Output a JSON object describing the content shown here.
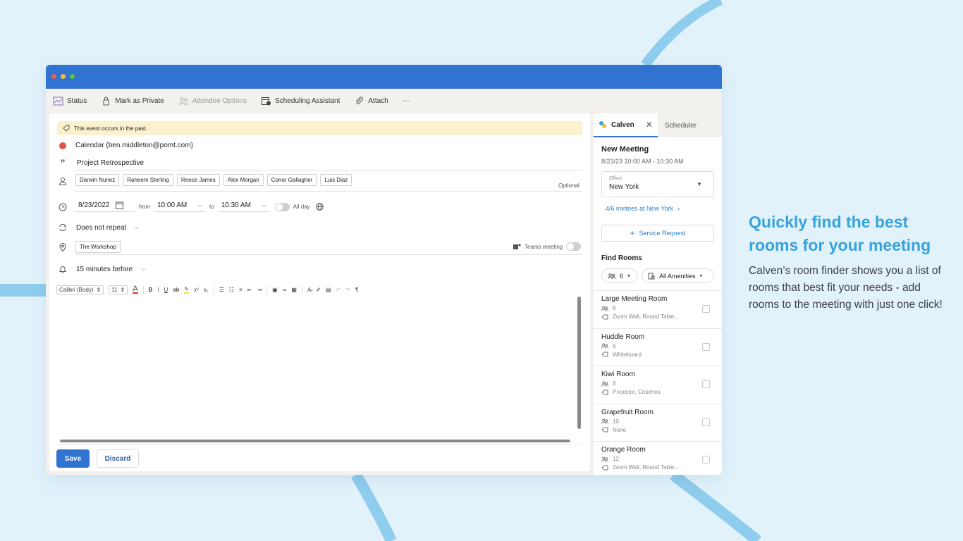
{
  "toolbar": {
    "items": [
      {
        "label": "Status",
        "icon": "status-icon"
      },
      {
        "label": "Mark as Private",
        "icon": "lock-icon"
      },
      {
        "label": "Attendee Options",
        "icon": "people-icon"
      },
      {
        "label": "Scheduling Assistant",
        "icon": "calendar-clock-icon"
      },
      {
        "label": "Attach",
        "icon": "paperclip-icon"
      }
    ],
    "more": "···"
  },
  "event": {
    "banner": "This event occurs in the past.",
    "calendar": "Calendar (ben.middleton@pomt.com)",
    "title": "Project Retrospective",
    "attendees": [
      "Darwin Nunez",
      "Raheem Sterling",
      "Reece James",
      "Alex Morgan",
      "Conor Gallagher",
      "Luis Diaz"
    ],
    "optional_label": "Optional",
    "date": "8/23/2022",
    "from_label": "from",
    "start_time": "10:00 AM",
    "to_label": "to",
    "end_time": "10:30 AM",
    "all_day_label": "All day",
    "repeat": "Does not repeat",
    "location": "The Workshop",
    "teams_label": "Teams meeting",
    "reminder": "15 minutes before",
    "font": "Calibri (Body)",
    "font_size": "11"
  },
  "actions": {
    "save": "Save",
    "discard": "Discard"
  },
  "panel": {
    "tab_active": "Calven",
    "tab_inactive": "Scheduler",
    "meeting_title": "New Meeting",
    "meeting_time": "8/23/23 10:00 AM - 10:30 AM",
    "office_label": "Office",
    "office_value": "New York",
    "invitees_link": "4/6 invitees at New York",
    "service_request": "Service Request",
    "find_rooms": "Find Rooms",
    "capacity_filter": "6",
    "amenities_filter": "All Amenities",
    "rooms": [
      {
        "name": "Large Meeting Room",
        "capacity": "6",
        "amenities": "Zoom Wall, Round Table..."
      },
      {
        "name": "Huddle Room",
        "capacity": "6",
        "amenities": "Whiteboard"
      },
      {
        "name": "Kiwi Room",
        "capacity": "8",
        "amenities": "Projector, Couches"
      },
      {
        "name": "Grapefruit Room",
        "capacity": "10",
        "amenities": "None"
      },
      {
        "name": "Orange Room",
        "capacity": "12",
        "amenities": "Zoom Wall, Round Table..."
      }
    ]
  },
  "promo": {
    "title": "Quickly find the best rooms for your meeting",
    "body": "Calven’s room finder shows you a list of rooms that best fit your needs - add rooms to the meeting with just one click!"
  },
  "colors": {
    "accent": "#3173d0",
    "promo_title": "#36a3dc",
    "background": "#e1f2fb",
    "decor_arc": "#8fcdee"
  }
}
